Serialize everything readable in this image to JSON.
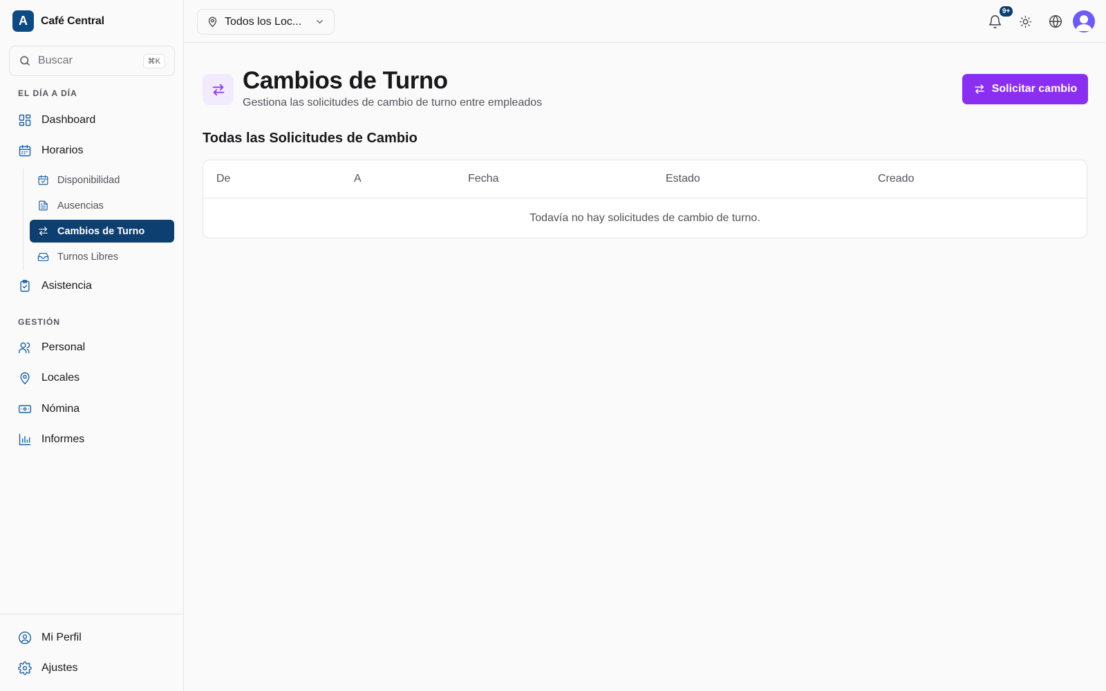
{
  "brand": {
    "logo_letter": "A",
    "name": "Café Central"
  },
  "search": {
    "placeholder": "Buscar",
    "shortcut": "⌘K"
  },
  "sidebar": {
    "section_day": "EL DÍA A DÍA",
    "section_management": "GESTIÓN",
    "items": {
      "dashboard": "Dashboard",
      "horarios": "Horarios",
      "asistencia": "Asistencia",
      "personal": "Personal",
      "locales": "Locales",
      "nomina": "Nómina",
      "informes": "Informes"
    },
    "sub_items": {
      "disponibilidad": "Disponibilidad",
      "ausencias": "Ausencias",
      "cambios": "Cambios de Turno",
      "turnos_libres": "Turnos Libres"
    },
    "footer": {
      "perfil": "Mi Perfil",
      "ajustes": "Ajustes"
    }
  },
  "topbar": {
    "location_select": "Todos los Loc...",
    "notifications_badge": "9+"
  },
  "page": {
    "title": "Cambios de Turno",
    "subtitle": "Gestiona las solicitudes de cambio de turno entre empleados",
    "primary_button": "Solicitar cambio",
    "section_title": "Todas las Solicitudes de Cambio"
  },
  "table": {
    "columns": [
      "De",
      "A",
      "Fecha",
      "Estado",
      "Creado"
    ],
    "empty_message": "Todavía no hay solicitudes de cambio de turno."
  },
  "colors": {
    "brand": "#0d4a84",
    "active_nav": "#0d3f70",
    "primary_button": "#8a2ff2",
    "icon_accent": "#1b5fa1"
  }
}
